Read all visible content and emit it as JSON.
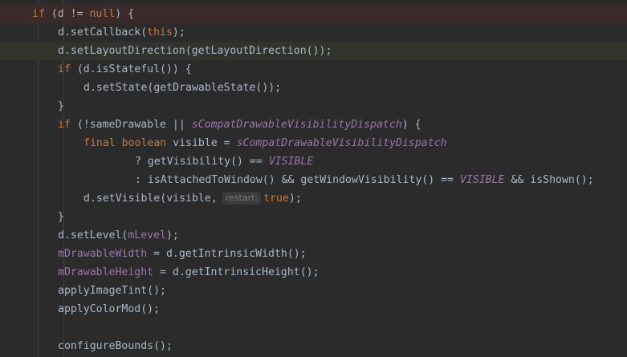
{
  "lines": [
    {
      "indent": 0,
      "hl": "top",
      "tokens": [
        {
          "t": "kw",
          "v": "if"
        },
        {
          "t": "p",
          "v": " (d != "
        },
        {
          "t": "kw",
          "v": "null"
        },
        {
          "t": "p",
          "v": ") {"
        }
      ]
    },
    {
      "indent": 1,
      "tokens": [
        {
          "t": "p",
          "v": "d.setCallback("
        },
        {
          "t": "kw",
          "v": "this"
        },
        {
          "t": "p",
          "v": ");"
        }
      ]
    },
    {
      "indent": 1,
      "hl": "current",
      "tokens": [
        {
          "t": "p",
          "v": "d.setLayoutDirection(getLayoutDirection());"
        }
      ]
    },
    {
      "indent": 1,
      "tokens": [
        {
          "t": "kw",
          "v": "if"
        },
        {
          "t": "p",
          "v": " (d.isStateful()) {"
        }
      ]
    },
    {
      "indent": 2,
      "tokens": [
        {
          "t": "p",
          "v": "d.setState(getDrawableState());"
        }
      ]
    },
    {
      "indent": 1,
      "tokens": [
        {
          "t": "p",
          "v": "}"
        }
      ]
    },
    {
      "indent": 1,
      "tokens": [
        {
          "t": "kw",
          "v": "if"
        },
        {
          "t": "p",
          "v": " (!sameDrawable || "
        },
        {
          "t": "sfld",
          "v": "sCompatDrawableVisibilityDispatch"
        },
        {
          "t": "p",
          "v": ") {"
        }
      ]
    },
    {
      "indent": 2,
      "tokens": [
        {
          "t": "kw",
          "v": "final boolean"
        },
        {
          "t": "p",
          "v": " visible = "
        },
        {
          "t": "sfld",
          "v": "sCompatDrawableVisibilityDispatch"
        }
      ]
    },
    {
      "indent": 4,
      "tokens": [
        {
          "t": "p",
          "v": "? getVisibility() == "
        },
        {
          "t": "sfld",
          "v": "VISIBLE"
        }
      ]
    },
    {
      "indent": 4,
      "tokens": [
        {
          "t": "p",
          "v": ": isAttachedToWindow() && getWindowVisibility() == "
        },
        {
          "t": "sfld",
          "v": "VISIBLE"
        },
        {
          "t": "p",
          "v": " && isShown();"
        }
      ]
    },
    {
      "indent": 2,
      "tokens": [
        {
          "t": "p",
          "v": "d.setVisible(visible,"
        },
        {
          "t": "hint",
          "v": "restart:"
        },
        {
          "t": "kw",
          "v": "true"
        },
        {
          "t": "p",
          "v": ");"
        }
      ]
    },
    {
      "indent": 1,
      "tokens": [
        {
          "t": "p",
          "v": "}"
        }
      ]
    },
    {
      "indent": 1,
      "tokens": [
        {
          "t": "p",
          "v": "d.setLevel("
        },
        {
          "t": "fld",
          "v": "mLevel"
        },
        {
          "t": "p",
          "v": ");"
        }
      ]
    },
    {
      "indent": 1,
      "tokens": [
        {
          "t": "fld",
          "v": "mDrawableWidth"
        },
        {
          "t": "p",
          "v": " = d.getIntrinsicWidth();"
        }
      ]
    },
    {
      "indent": 1,
      "tokens": [
        {
          "t": "fld",
          "v": "mDrawableHeight"
        },
        {
          "t": "p",
          "v": " = d.getIntrinsicHeight();"
        }
      ]
    },
    {
      "indent": 1,
      "tokens": [
        {
          "t": "p",
          "v": "applyImageTint();"
        }
      ]
    },
    {
      "indent": 1,
      "tokens": [
        {
          "t": "p",
          "v": "applyColorMod();"
        }
      ]
    },
    {
      "indent": 1,
      "tokens": []
    },
    {
      "indent": 1,
      "tokens": [
        {
          "t": "p",
          "v": "configureBounds();"
        }
      ]
    }
  ],
  "colors": {
    "background": "#2b2b2b",
    "plain": "#a9b7c6",
    "keyword": "#cc7832",
    "field": "#9876aa",
    "hint": "#787878"
  }
}
